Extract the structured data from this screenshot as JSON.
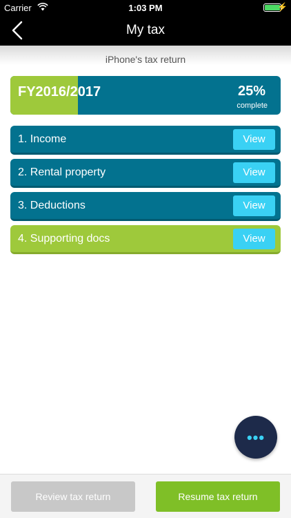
{
  "status_bar": {
    "carrier": "Carrier",
    "time": "1:03 PM",
    "charge_glyph": "⚡"
  },
  "nav": {
    "title": "My tax",
    "back_icon": "chevron-left-icon"
  },
  "subtitle": "iPhone's tax return",
  "fy_card": {
    "label": "FY2016/2017",
    "percent": "25%",
    "percent_label": "complete",
    "progress_fraction": 0.25
  },
  "sections": [
    {
      "label": "1. Income",
      "button": "View",
      "color": "#03728f"
    },
    {
      "label": "2. Rental property",
      "button": "View",
      "color": "#03728f"
    },
    {
      "label": "3. Deductions",
      "button": "View",
      "color": "#03728f"
    },
    {
      "label": "4. Supporting docs",
      "button": "View",
      "color": "#9ec93b"
    }
  ],
  "fab": {
    "icon": "more-icon",
    "glyph": "•••"
  },
  "footer": {
    "review_label": "Review tax return",
    "resume_label": "Resume tax return"
  },
  "colors": {
    "teal": "#03728f",
    "green": "#9ec93b",
    "cyan": "#3ad1f4",
    "navy": "#1d2a4a"
  }
}
